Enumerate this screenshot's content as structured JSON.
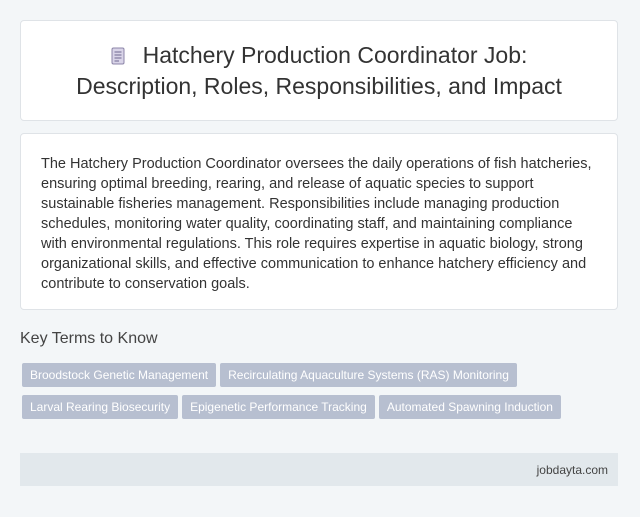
{
  "header": {
    "title": "Hatchery Production Coordinator Job: Description, Roles, Responsibilities, and Impact",
    "icon": "document-icon"
  },
  "description": {
    "text": "The Hatchery Production Coordinator oversees the daily operations of fish hatcheries, ensuring optimal breeding, rearing, and release of aquatic species to support sustainable fisheries management. Responsibilities include managing production schedules, monitoring water quality, coordinating staff, and maintaining compliance with environmental regulations. This role requires expertise in aquatic biology, strong organizational skills, and effective communication to enhance hatchery efficiency and contribute to conservation goals."
  },
  "key_terms": {
    "heading": "Key Terms to Know",
    "tags": [
      "Broodstock Genetic Management",
      "Recirculating Aquaculture Systems (RAS) Monitoring",
      "Larval Rearing Biosecurity",
      "Epigenetic Performance Tracking",
      "Automated Spawning Induction"
    ]
  },
  "footer": {
    "site": "jobdayta.com"
  },
  "colors": {
    "background": "#f3f6f8",
    "tag_background": "#b7bfd0",
    "footer_background": "#e2e8ec"
  }
}
